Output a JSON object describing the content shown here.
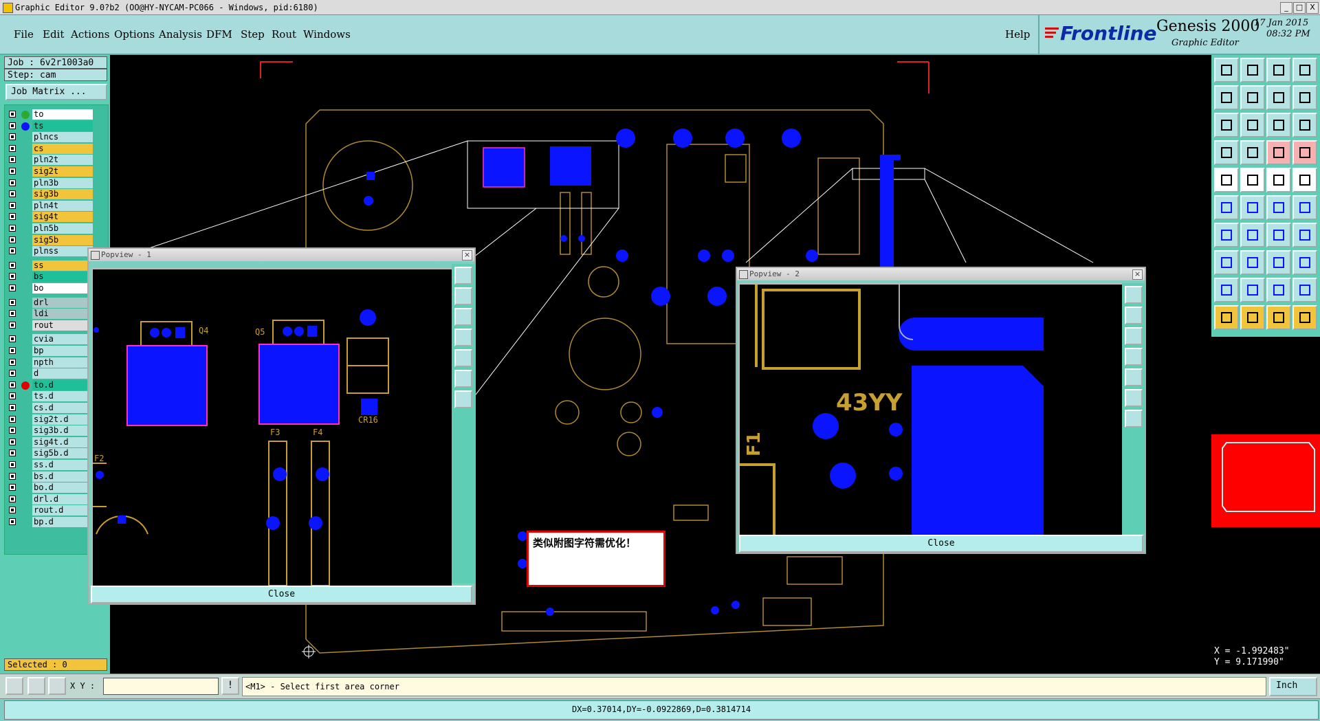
{
  "window": {
    "title": "Graphic Editor 9.0?b2 (OO@HY-NYCAM-PC066 - Windows, pid:6180)",
    "btn_min": "_",
    "btn_max": "□",
    "btn_close": "X"
  },
  "menu": {
    "items": [
      "File",
      "Edit",
      "Actions",
      "Options",
      "Analysis",
      "DFM",
      "Step",
      "Rout",
      "Windows"
    ],
    "help": "Help"
  },
  "brand": {
    "logo": "Frontline",
    "product": "Genesis 2000",
    "subtitle": "Graphic Editor",
    "date": "17 Jan 2015",
    "time": "08:32 PM"
  },
  "left_panel": {
    "job": "Job : 6v2r1003a0",
    "step": "Step: cam",
    "job_matrix": "Job Matrix ...",
    "layers": [
      {
        "name": "to",
        "color": "#ffffff",
        "dot": "#2ea82e"
      },
      {
        "name": "ts",
        "color": "#1fbf9a",
        "dot": "#1010ff"
      },
      {
        "name": "plncs",
        "color": "#b5e3e3",
        "dot": ""
      },
      {
        "name": "cs",
        "color": "#f2c43c",
        "dot": ""
      },
      {
        "name": "pln2t",
        "color": "#b5e3e3",
        "dot": ""
      },
      {
        "name": "sig2t",
        "color": "#f2c43c",
        "dot": ""
      },
      {
        "name": "pln3b",
        "color": "#b5e3e3",
        "dot": ""
      },
      {
        "name": "sig3b",
        "color": "#f2c43c",
        "dot": ""
      },
      {
        "name": "pln4t",
        "color": "#b5e3e3",
        "dot": ""
      },
      {
        "name": "sig4t",
        "color": "#f2c43c",
        "dot": ""
      },
      {
        "name": "pln5b",
        "color": "#b5e3e3",
        "dot": ""
      },
      {
        "name": "sig5b",
        "color": "#f2c43c",
        "dot": ""
      },
      {
        "name": "plnss",
        "color": "#b5e3e3",
        "dot": ""
      },
      {
        "name": "ss",
        "color": "#f2c43c",
        "dot": ""
      },
      {
        "name": "bs",
        "color": "#1fbf9a",
        "dot": ""
      },
      {
        "name": "bo",
        "color": "#ffffff",
        "dot": ""
      },
      {
        "name": "drl",
        "color": "#a9c7c7",
        "dot": ""
      },
      {
        "name": "ldi",
        "color": "#a9c7c7",
        "dot": ""
      },
      {
        "name": "rout",
        "color": "#dddddd",
        "dot": ""
      },
      {
        "name": "cvia",
        "color": "#b5e3e3",
        "dot": ""
      },
      {
        "name": "bp",
        "color": "#b5e3e3",
        "dot": ""
      },
      {
        "name": "npth",
        "color": "#b5e3e3",
        "dot": ""
      },
      {
        "name": "d",
        "color": "#b5e3e3",
        "dot": ""
      },
      {
        "name": "to.d",
        "color": "#1fbf9a",
        "dot": "#e00000"
      },
      {
        "name": "ts.d",
        "color": "#b5e3e3",
        "dot": ""
      },
      {
        "name": "cs.d",
        "color": "#b5e3e3",
        "dot": ""
      },
      {
        "name": "sig2t.d",
        "color": "#b5e3e3",
        "dot": ""
      },
      {
        "name": "sig3b.d",
        "color": "#b5e3e3",
        "dot": ""
      },
      {
        "name": "sig4t.d",
        "color": "#b5e3e3",
        "dot": ""
      },
      {
        "name": "sig5b.d",
        "color": "#b5e3e3",
        "dot": ""
      },
      {
        "name": "ss.d",
        "color": "#b5e3e3",
        "dot": ""
      },
      {
        "name": "bs.d",
        "color": "#b5e3e3",
        "dot": ""
      },
      {
        "name": "bo.d",
        "color": "#b5e3e3",
        "dot": ""
      },
      {
        "name": "drl.d",
        "color": "#b5e3e3",
        "dot": ""
      },
      {
        "name": "rout.d",
        "color": "#b5e3e3",
        "dot": ""
      },
      {
        "name": "bp.d",
        "color": "#b5e3e3",
        "dot": ""
      }
    ],
    "selected": "Selected : 0"
  },
  "popview1": {
    "title": "Popview - 1",
    "close": "Close",
    "labels": {
      "q4": "Q4",
      "q5": "Q5",
      "cr16": "CR16",
      "f2": "F2",
      "f3": "F3",
      "f4": "F4"
    }
  },
  "popview2": {
    "title": "Popview - 2",
    "close": "Close",
    "labels": {
      "ref": "43YY",
      "f1": "F1"
    }
  },
  "note": {
    "text": "类似附图字符需优化！"
  },
  "coords": {
    "x": "X = -1.992483\"",
    "y": "Y =  9.171990\""
  },
  "command": {
    "xy_label": "X Y :",
    "xy_value": "",
    "prompt": "<M1> - Select first area corner",
    "units": "Inch"
  },
  "status": {
    "measure": "DX=0.37014,DY=-0.0922869,D=0.3814714"
  },
  "colors": {
    "pad": "#0a14ff",
    "silk": "#c8a032",
    "highlight": "#ff30c0",
    "note_border": "#e00000"
  }
}
